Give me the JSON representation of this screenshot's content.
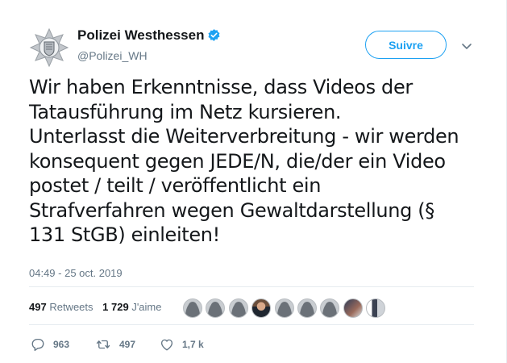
{
  "author": {
    "name": "Polizei Westhessen",
    "handle": "@Polizei_WH",
    "verified": true
  },
  "follow_button": {
    "label": "Suivre"
  },
  "tweet": {
    "lines": [
      "Wir haben Erkenntnisse, dass Videos der",
      "Tatausführung im Netz kursieren.",
      "Unterlasst die Weiterverbreitung - wir werden",
      "konsequent gegen JEDE/N, die/der ein Video",
      "postet / teilt / veröffentlicht ein",
      "Strafverfahren wegen Gewaltdarstellung (§",
      "131 StGB) einleiten!"
    ],
    "timestamp": "04:49 - 25 oct. 2019"
  },
  "stats": {
    "retweets_count": "497",
    "retweets_label": "Retweets",
    "likes_count": "1 729",
    "likes_label": "J'aime"
  },
  "actions": {
    "reply_count": "963",
    "retweet_count": "497",
    "like_count": "1,7 k"
  },
  "colors": {
    "accent": "#1da1f2",
    "muted": "#657786",
    "text": "#14171a"
  },
  "icons": [
    "police-star-avatar",
    "verified-badge-icon",
    "chevron-down-icon",
    "reply-icon",
    "retweet-icon",
    "heart-icon"
  ]
}
